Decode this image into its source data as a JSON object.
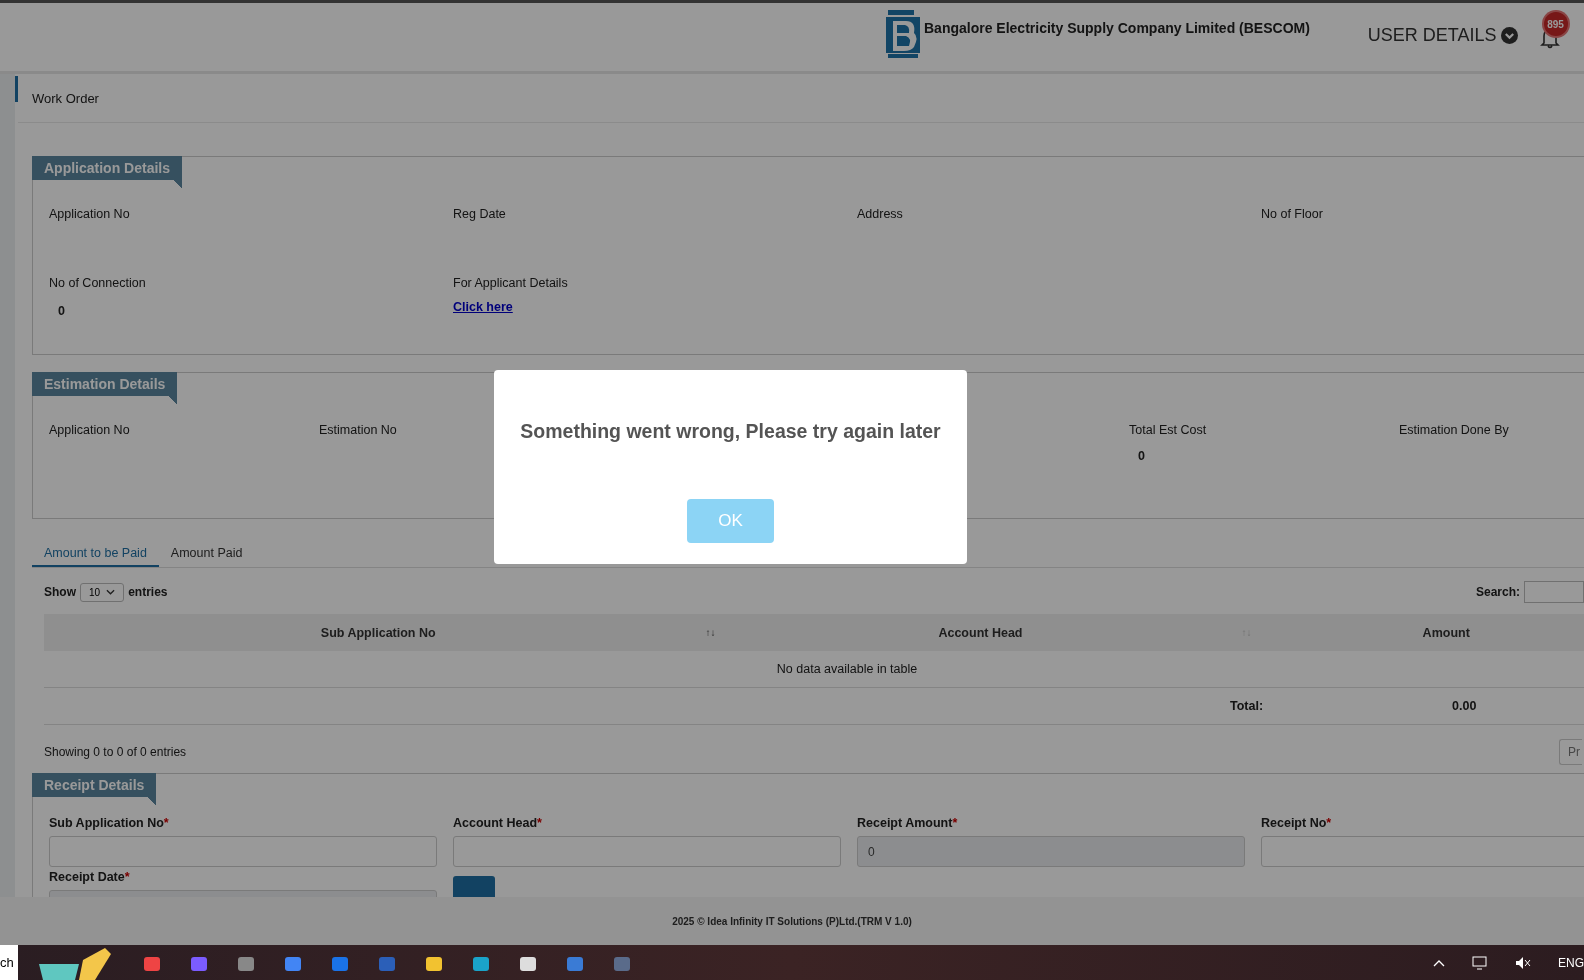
{
  "header": {
    "company": "Bangalore Electricity Supply Company Limited (BESCOM)",
    "user_menu": "USER DETAILS",
    "notification_count": "895"
  },
  "breadcrumb": "Work Order",
  "application_details": {
    "title": "Application Details",
    "fields": [
      {
        "label": "Application No",
        "kind": "text"
      },
      {
        "label": "Reg Date",
        "kind": "text"
      },
      {
        "label": "Address",
        "kind": "text"
      },
      {
        "label": "No of Floor",
        "kind": "text"
      },
      {
        "label": "No of Connection",
        "kind": "text",
        "value": "0"
      },
      {
        "label": "For Applicant Details",
        "kind": "link",
        "value": "Click here"
      }
    ]
  },
  "estimation_details": {
    "title": "Estimation Details",
    "fields": [
      {
        "label": "Application No"
      },
      {
        "label": "Estimation No"
      },
      {
        "label": "Total Est Cost",
        "value": "0"
      },
      {
        "label": "Estimation Done By"
      }
    ]
  },
  "tabs": [
    {
      "label": "Amount to be Paid",
      "selected": true
    },
    {
      "label": "Amount Paid",
      "selected": false
    }
  ],
  "table": {
    "show_label": "Show",
    "page_size": "10",
    "entries_label": "entries",
    "search_label": "Search:",
    "columns": [
      {
        "label": "Sub Application No",
        "sort": "↑↓",
        "sort_active": true
      },
      {
        "label": "Account Head",
        "sort": "↑↓",
        "sort_active": false
      },
      {
        "label": "Amount"
      }
    ],
    "empty_message": "No data available in table",
    "total_label": "Total:",
    "total": "0.00",
    "info": "Showing 0 to 0 of 0 entries",
    "pager": "Pr"
  },
  "receipt_details": {
    "title": "Receipt Details",
    "fields": [
      {
        "label": "Sub Application No",
        "required_mark": "*",
        "disabled": false
      },
      {
        "label": "Account Head",
        "required_mark": "*",
        "disabled": false
      },
      {
        "label": "Receipt Amount",
        "required_mark": "*",
        "disabled": true,
        "value": "0"
      },
      {
        "label": "Receipt No",
        "required_mark": "*",
        "disabled": false
      },
      {
        "label": "Receipt Date",
        "required_mark": "*",
        "disabled": true
      }
    ]
  },
  "footer": "2025 © Idea Infinity IT Solutions (P)Ltd.(TRM V 1.0)",
  "dialog": {
    "message": "Something went wrong, Please try again later",
    "button": "OK"
  },
  "taskbar": {
    "search_text": "ch",
    "language": "ENG"
  }
}
